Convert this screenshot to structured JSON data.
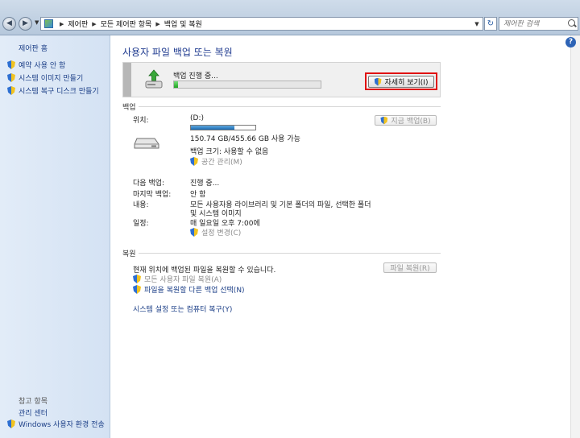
{
  "address_bar": {
    "breadcrumbs": [
      "제어판",
      "모든 제어판 항목",
      "백업 및 복원"
    ],
    "search_placeholder": "제어판 검색"
  },
  "sidebar": {
    "home": "제어판 홈",
    "tasks": [
      "예약 사용 안 함",
      "시스템 이미지 만들기",
      "시스템 복구 디스크 만들기"
    ],
    "see_also_title": "참고 항목",
    "see_also": [
      "관리 센터",
      "Windows 사용자 환경 전송"
    ]
  },
  "main": {
    "title": "사용자 파일 백업 또는 복원",
    "progress": {
      "label": "백업 진행 중...",
      "fraction": 0.03,
      "details_button": "자세히 보기(I)"
    },
    "backup": {
      "section_label": "백업",
      "location_label": "위치:",
      "location_value": "(D:)",
      "drive_used_fraction": 0.67,
      "free_space": "150.74 GB/455.66 GB 사용 가능",
      "backup_size": "백업 크기: 사용할 수 없음",
      "manage_space_link": "공간 관리(M)",
      "backup_now_button": "지금 백업(B)",
      "next_backup_label": "다음 백업:",
      "next_backup_value": "진행 중...",
      "last_backup_label": "마지막 백업:",
      "last_backup_value": "안 함",
      "contents_label": "내용:",
      "contents_line1": "모든 사용자용 라이브러리 및 기본 폴더의 파일, 선택한 폴더",
      "contents_line2": "및 시스템 이미지",
      "schedule_label": "일정:",
      "schedule_value": "매 일요일 오후 7:00에",
      "change_settings_link": "설정 변경(C)"
    },
    "restore": {
      "section_label": "복원",
      "description": "현재 위치에 백업된 파일을 복원할 수 있습니다.",
      "restore_files_button": "파일 복원(R)",
      "restore_all_users_link": "모든 사용자 파일 복원(A)",
      "select_other_backup_link": "파일을 복원할 다른 백업 선택(N)",
      "recover_system_link": "시스템 설정 또는 컴퓨터 복구(Y)"
    }
  }
}
